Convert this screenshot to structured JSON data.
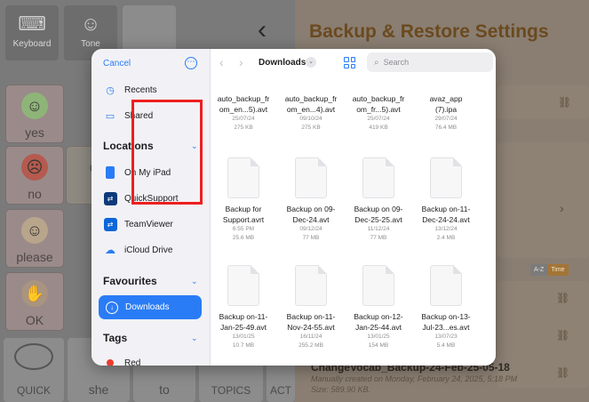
{
  "background": {
    "toolbar": [
      {
        "label": "Keyboard",
        "icon": "keyboard-icon"
      },
      {
        "label": "Tone",
        "icon": "smiley-icon"
      }
    ],
    "tiles": [
      {
        "label": "yes",
        "icon": "smiley-face-icon"
      },
      {
        "label": "no",
        "icon": "sad-face-icon"
      },
      {
        "label": "please",
        "icon": "person-icon"
      },
      {
        "label": "OK",
        "icon": "ok-hand-icon"
      }
    ],
    "bottom_tiles": [
      "QUICK",
      "she",
      "to",
      "TOPICS",
      "ACT"
    ],
    "title": "Backup & Restore Settings",
    "sort_tabs": [
      "A-Z",
      "Time"
    ],
    "entry": {
      "title": "ChangeVocab_Backup-24-Feb-25-05-18",
      "created": "Manually created on Monday, February 24, 2025, 5:18 PM",
      "size": "Size: 589.90 KB."
    }
  },
  "picker": {
    "cancel_label": "Cancel",
    "more_glyph": "⋯",
    "recents_label": "Recents",
    "shared_label": "Shared",
    "locations_heading": "Locations",
    "locations": [
      "On My iPad",
      "QuickSupport",
      "TeamViewer",
      "iCloud Drive"
    ],
    "favourites_heading": "Favourites",
    "favourites": [
      "Downloads"
    ],
    "tags_heading": "Tags",
    "tags": [
      "Red"
    ],
    "folder_title": "Downloads",
    "search_placeholder": "Search",
    "files_top": [
      {
        "name1": "auto_backup_fr",
        "name2": "om_en...5).avt",
        "date": "25/07/24",
        "size": "275 KB"
      },
      {
        "name1": "auto_backup_fr",
        "name2": "om_en...4).avt",
        "date": "09/10/24",
        "size": "275 KB"
      },
      {
        "name1": "auto_backup_fr",
        "name2": "om_fr...5).avt",
        "date": "25/07/24",
        "size": "419 KB"
      },
      {
        "name1": "avaz_app",
        "name2": "(7).ipa",
        "date": "29/07/24",
        "size": "76.4 MB"
      }
    ],
    "files_mid": [
      {
        "name1": "Backup for",
        "name2": "Support.avrt",
        "date": "6:55 PM",
        "size": "25.6 MB"
      },
      {
        "name1": "Backup on 09-",
        "name2": "Dec-24.avt",
        "date": "09/12/24",
        "size": "77 MB"
      },
      {
        "name1": "Backup on 09-",
        "name2": "Dec-25-25.avt",
        "date": "11/12/24",
        "size": "77 MB"
      },
      {
        "name1": "Backup on-11-",
        "name2": "Dec-24-24.avt",
        "date": "13/12/24",
        "size": "2.4 MB"
      }
    ],
    "files_bottom": [
      {
        "name1": "Backup on-11-",
        "name2": "Jan-25-49.avt",
        "date": "13/01/25",
        "size": "10.7 MB"
      },
      {
        "name1": "Backup on-11-",
        "name2": "Nov-24-55.avt",
        "date": "16/11/24",
        "size": "255.2 MB"
      },
      {
        "name1": "Backup on-12-",
        "name2": "Jan-25-44.avt",
        "date": "13/01/25",
        "size": "154 MB"
      },
      {
        "name1": "Backup on-13-",
        "name2": "Jul-23...es.avt",
        "date": "13/07/23",
        "size": "5.4 MB"
      }
    ]
  },
  "colors": {
    "accent": "#2a7cf6",
    "highlight": "#ee1f1f",
    "title_brown": "#6b4a1f"
  }
}
